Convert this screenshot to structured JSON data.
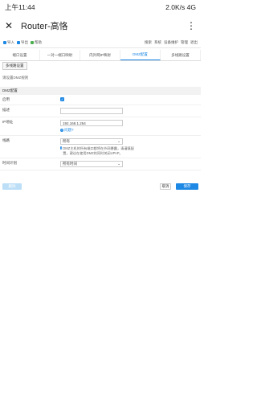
{
  "status": {
    "time": "上午11:44",
    "speed": "2.0K/s",
    "network": "4G"
  },
  "app": {
    "title": "Router-高恪"
  },
  "toolbar": {
    "left": [
      "导入",
      "导出",
      "帮助"
    ],
    "right": [
      "搜索",
      "系统",
      "设备维护",
      "管理",
      "退出"
    ]
  },
  "tabs": [
    "端口设置",
    "一对一端口映射",
    "内外网IP映射",
    "DMZ配置",
    "多线路设置"
  ],
  "subtab": "多线路设置",
  "hint": "请设置DMZ规则",
  "section": {
    "title": "DMZ配置"
  },
  "form": {
    "enable_label": "启用",
    "name_label": "描述",
    "name_value": "",
    "ip_label": "IP地址",
    "ip_value": "192.168.1.254",
    "ip_help": "问题?",
    "line_label": "线路",
    "line_value": "所有",
    "line_note": "DMZ主机的所有端口都将在外网暴露，请谨慎配置，建议在使用DMZ的同时关闭UPnP。",
    "group_label": "时间计划",
    "group_value": "所有时间"
  },
  "buttons": {
    "delete": "删除",
    "cancel": "取消",
    "save": "保存"
  },
  "colors": {
    "accent": "#1e88e5"
  }
}
